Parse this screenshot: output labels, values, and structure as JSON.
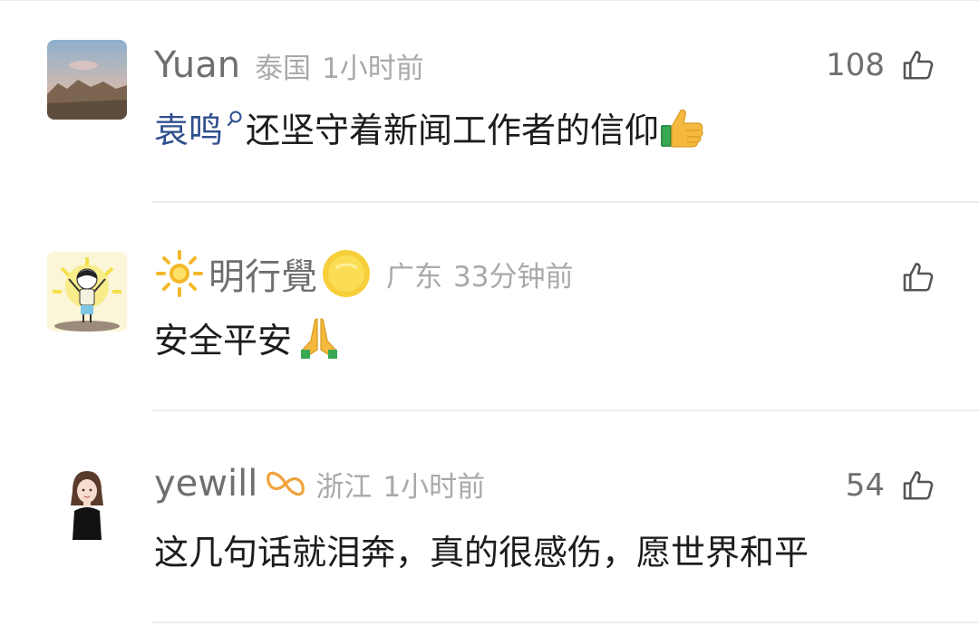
{
  "comments": [
    {
      "username": "Yuan",
      "location": "泰国",
      "time": "1小时前",
      "likes": "108",
      "mention": "袁鸣",
      "text": "还坚守着新闻工作者的信仰"
    },
    {
      "username": "明行覺",
      "location": "广东",
      "time": "33分钟前",
      "likes": "",
      "text": "安全平安"
    },
    {
      "username": "yewill",
      "location": "浙江",
      "time": "1小时前",
      "likes": "54",
      "text": "这几句话就泪奔，真的很感伤，愿世界和平"
    }
  ],
  "colors": {
    "username": "#6f6f6f",
    "meta": "#a9a9a9",
    "mention": "#2f4f8f",
    "badge": "#f0a23b"
  },
  "icons": {
    "like": "thumbs-up-outline-icon",
    "search": "search-icon",
    "sun": "sun-icon",
    "coin": "gold-circle-icon",
    "badge": "infinity-badge-icon",
    "thumbs_emoji": "thumbs-up-emoji-icon",
    "pray_emoji": "praying-hands-emoji-icon"
  }
}
